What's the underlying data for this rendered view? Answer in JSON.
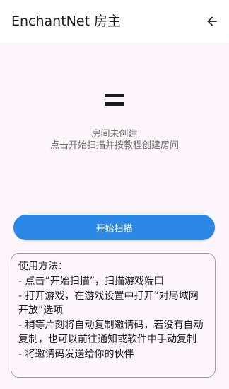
{
  "app_bar": {
    "title": "EnchantNet 房主",
    "back_icon": "arrow-back-icon"
  },
  "status": {
    "icon": "equals-icon",
    "line1": "房间未创建",
    "line2": "点击开始扫描并按教程创建房间"
  },
  "scan_button": {
    "label": "开始扫描",
    "color": "#2a89e6"
  },
  "usage": {
    "title": "使用方法：",
    "steps": [
      " - 点击“开始扫描”，扫描游戏端口",
      " - 打开游戏，在游戏设置中打开“对局域网开放”选项",
      " - 稍等片刻将自动复制邀请码，若没有自动复制，也可以前往通知或软件中手动复制",
      " - 将邀请码发送给你的伙伴"
    ]
  }
}
